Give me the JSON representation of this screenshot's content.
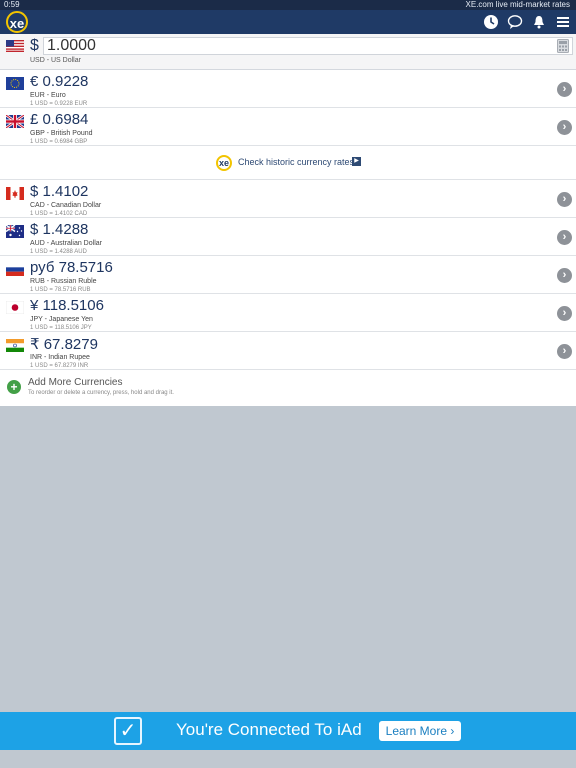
{
  "status_bar": {
    "time": "0:59",
    "right_text": "XE.com live mid-market rates"
  },
  "nav": {
    "logo": "xe",
    "icons": [
      "history-clock-icon",
      "chat-bubble-icon",
      "bell-icon",
      "menu-icon"
    ]
  },
  "base": {
    "flag": "us",
    "symbol": "$",
    "amount": "1.0000",
    "name": "USD - US Dollar"
  },
  "currencies": [
    {
      "flag": "eu",
      "amount": "€ 0.9228",
      "name": "EUR - Euro",
      "rate": "1 USD = 0.9228 EUR"
    },
    {
      "flag": "gb",
      "amount": "£ 0.6984",
      "name": "GBP - British Pound",
      "rate": "1 USD = 0.6984 GBP"
    },
    {
      "flag": "ca",
      "amount": "$ 1.4102",
      "name": "CAD - Canadian Dollar",
      "rate": "1 USD = 1.4102 CAD"
    },
    {
      "flag": "au",
      "amount": "$ 1.4288",
      "name": "AUD - Australian Dollar",
      "rate": "1 USD = 1.4288 AUD"
    },
    {
      "flag": "ru",
      "amount": "руб 78.5716",
      "name": "RUB - Russian Ruble",
      "rate": "1 USD = 78.5716 RUB"
    },
    {
      "flag": "jp",
      "amount": "¥ 118.5106",
      "name": "JPY - Japanese Yen",
      "rate": "1 USD = 118.5106 JPY"
    },
    {
      "flag": "in",
      "amount": "₹ 67.8279",
      "name": "INR - Indian Rupee",
      "rate": "1 USD = 67.8279 INR"
    }
  ],
  "historic": {
    "label": "Check historic currency rates",
    "logo": "xe"
  },
  "add_more": {
    "title": "Add More Currencies",
    "hint": "To reorder or delete a currency, press, hold and drag it."
  },
  "ad": {
    "text": "You're Connected To iAd",
    "button": "Learn More ›"
  },
  "colors": {
    "nav": "#1f3a66",
    "amount_text": "#1e3560",
    "ad_background": "#1da2e6",
    "empty_area": "#c0c8d0"
  }
}
